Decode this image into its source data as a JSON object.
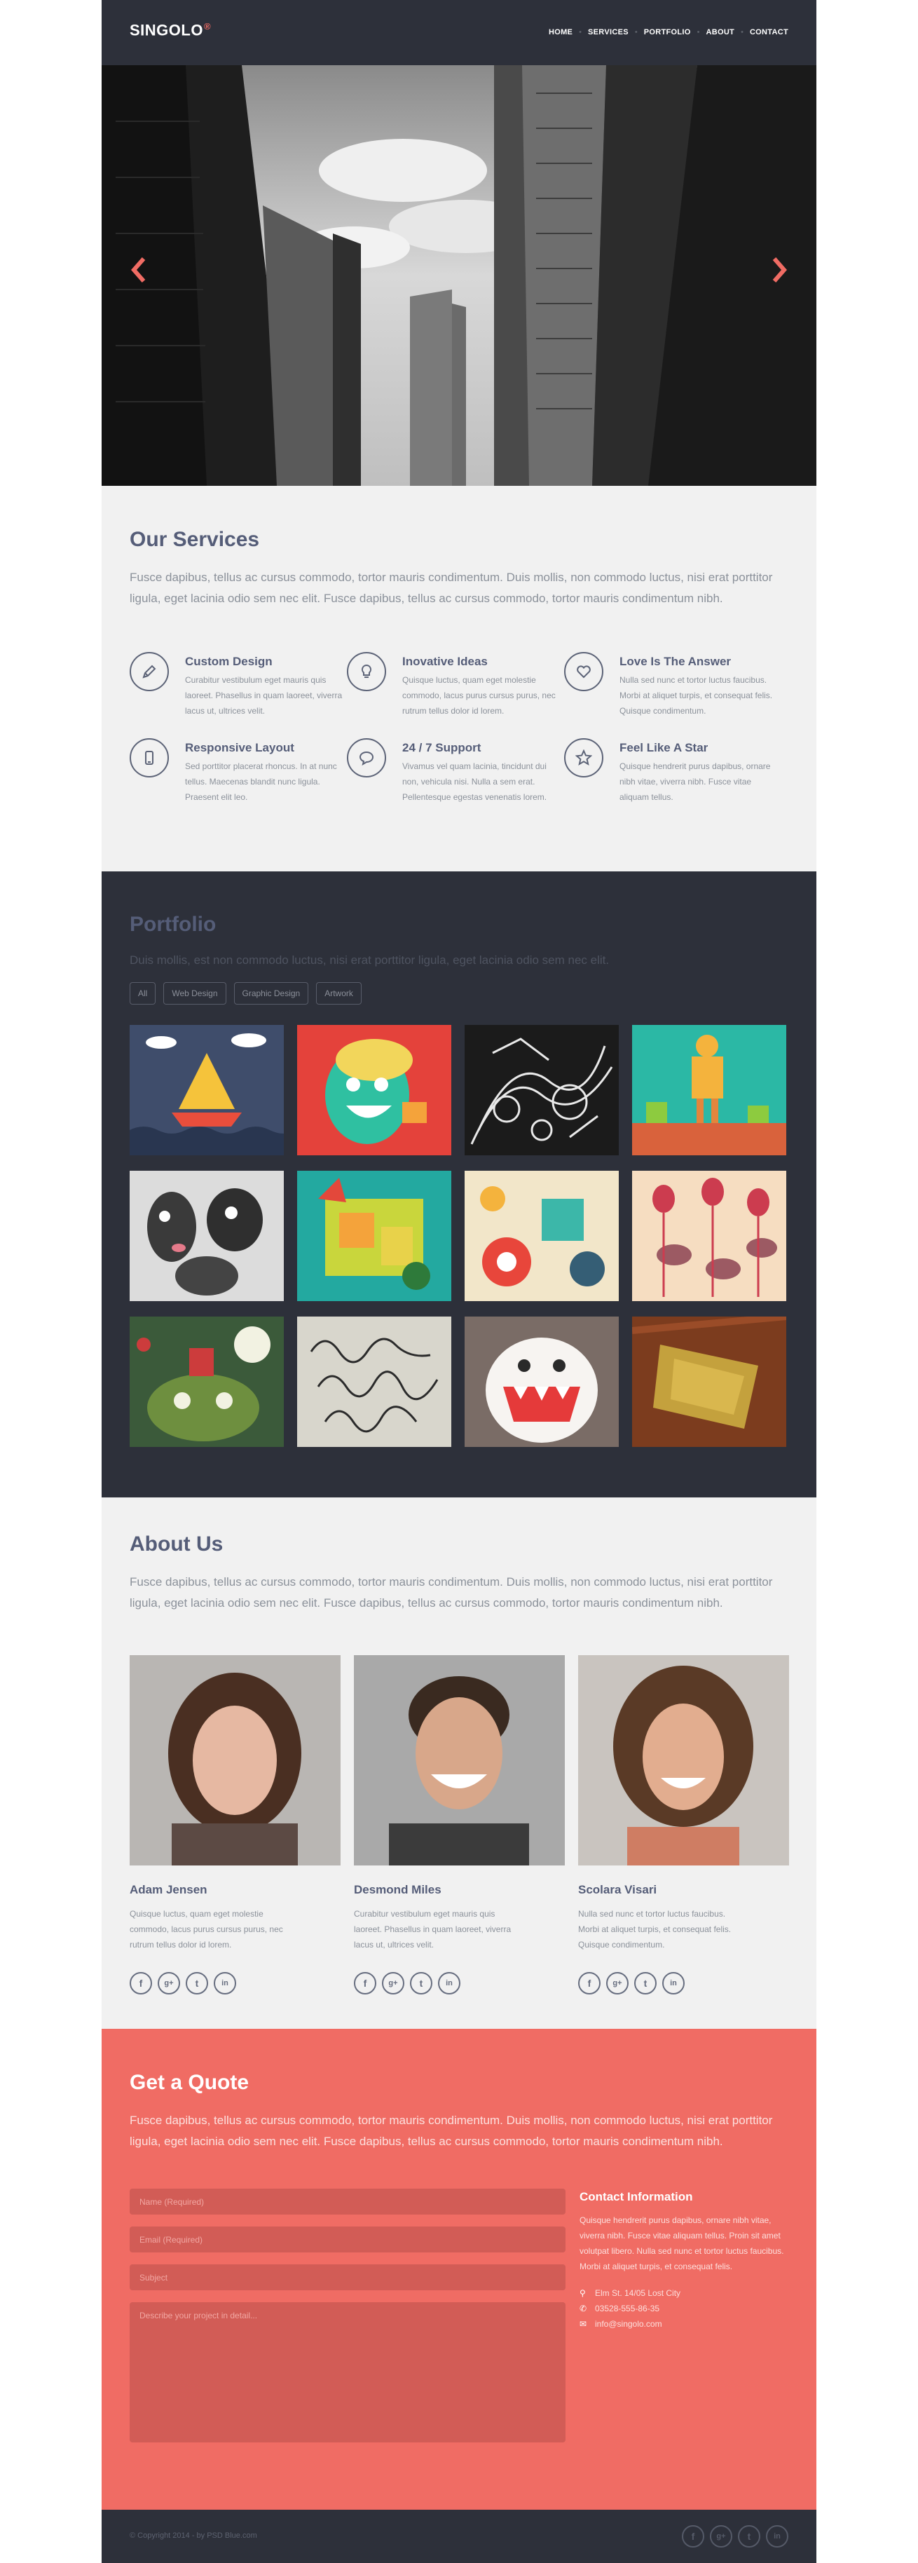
{
  "header": {
    "logo": "SINGOLO",
    "logo_mark": "®",
    "nav": [
      "HOME",
      "SERVICES",
      "PORTFOLIO",
      "ABOUT",
      "CONTACT"
    ]
  },
  "services": {
    "title": "Our Services",
    "description": "Fusce dapibus, tellus ac cursus commodo, tortor mauris condimentum. Duis mollis, non commodo luctus, nisi erat porttitor ligula, eget lacinia odio sem nec elit. Fusce dapibus, tellus ac cursus commodo, tortor mauris condimentum nibh.",
    "items": [
      {
        "icon": "pencil-icon",
        "title": "Custom Design",
        "text": "Curabitur vestibulum eget mauris quis laoreet. Phasellus in quam laoreet, viverra lacus ut, ultrices velit."
      },
      {
        "icon": "lightbulb-icon",
        "title": "Inovative Ideas",
        "text": "Quisque luctus, quam eget molestie commodo, lacus purus cursus purus, nec rutrum tellus dolor id lorem."
      },
      {
        "icon": "heart-icon",
        "title": "Love Is The Answer",
        "text": "Nulla sed nunc et tortor luctus faucibus. Morbi at aliquet turpis, et consequat felis. Quisque condimentum."
      },
      {
        "icon": "mobile-icon",
        "title": "Responsive Layout",
        "text": "Sed porttitor placerat rhoncus. In at nunc tellus. Maecenas blandit nunc ligula. Praesent elit leo."
      },
      {
        "icon": "chat-icon",
        "title": "24 / 7 Support",
        "text": "Vivamus vel quam lacinia, tincidunt dui non, vehicula nisi. Nulla a sem erat. Pellentesque egestas venenatis lorem."
      },
      {
        "icon": "star-icon",
        "title": "Feel Like A Star",
        "text": "Quisque hendrerit purus dapibus, ornare nibh vitae, viverra nibh. Fusce vitae aliquam tellus."
      }
    ]
  },
  "portfolio": {
    "title": "Portfolio",
    "description": "Duis mollis, est non commodo luctus, nisi erat porttitor ligula, eget lacinia odio sem nec elit.",
    "filters": [
      "All",
      "Web Design",
      "Graphic Design",
      "Artwork"
    ]
  },
  "about": {
    "title": "About Us",
    "description": "Fusce dapibus, tellus ac cursus commodo, tortor mauris condimentum. Duis mollis, non commodo luctus, nisi erat porttitor ligula, eget lacinia odio sem nec elit. Fusce dapibus, tellus ac cursus commodo, tortor mauris condimentum nibh.",
    "members": [
      {
        "name": "Adam Jensen",
        "text": "Quisque luctus, quam eget molestie commodo, lacus purus cursus purus, nec rutrum tellus dolor id lorem."
      },
      {
        "name": "Desmond Miles",
        "text": "Curabitur vestibulum eget mauris quis laoreet. Phasellus in quam laoreet, viverra lacus ut, ultrices velit."
      },
      {
        "name": "Scolara Visari",
        "text": "Nulla sed nunc et tortor luctus faucibus. Morbi at aliquet turpis, et consequat felis. Quisque condimentum."
      }
    ],
    "social_icons": [
      "f",
      "g+",
      "t",
      "in"
    ]
  },
  "quote": {
    "title": "Get a Quote",
    "description": "Fusce dapibus, tellus ac cursus commodo, tortor mauris condimentum. Duis mollis, non commodo luctus, nisi erat porttitor ligula, eget lacinia odio sem nec elit. Fusce dapibus, tellus ac cursus commodo, tortor mauris condimentum nibh.",
    "name_placeholder": "Name (Required)",
    "email_placeholder": "Email (Required)",
    "subject_placeholder": "Subject",
    "message_placeholder": "Describe your project in detail...",
    "contact_title": "Contact Information",
    "contact_text": "Quisque hendrerit purus dapibus, ornare nibh vitae, viverra nibh. Fusce vitae aliquam tellus. Proin sit amet volutpat libero. Nulla sed nunc et tortor luctus faucibus. Morbi at aliquet turpis, et consequat felis.",
    "address": "Elm St. 14/05 Lost City",
    "phone": "03528-555-86-35",
    "email": "info@singolo.com"
  },
  "footer": {
    "copyright": "© Copyright 2014 - by PSD Blue.com"
  },
  "colors": {
    "dark": "#2d303a",
    "light": "#f1f1f1",
    "accent": "#f06c64",
    "heading": "#555d78"
  }
}
